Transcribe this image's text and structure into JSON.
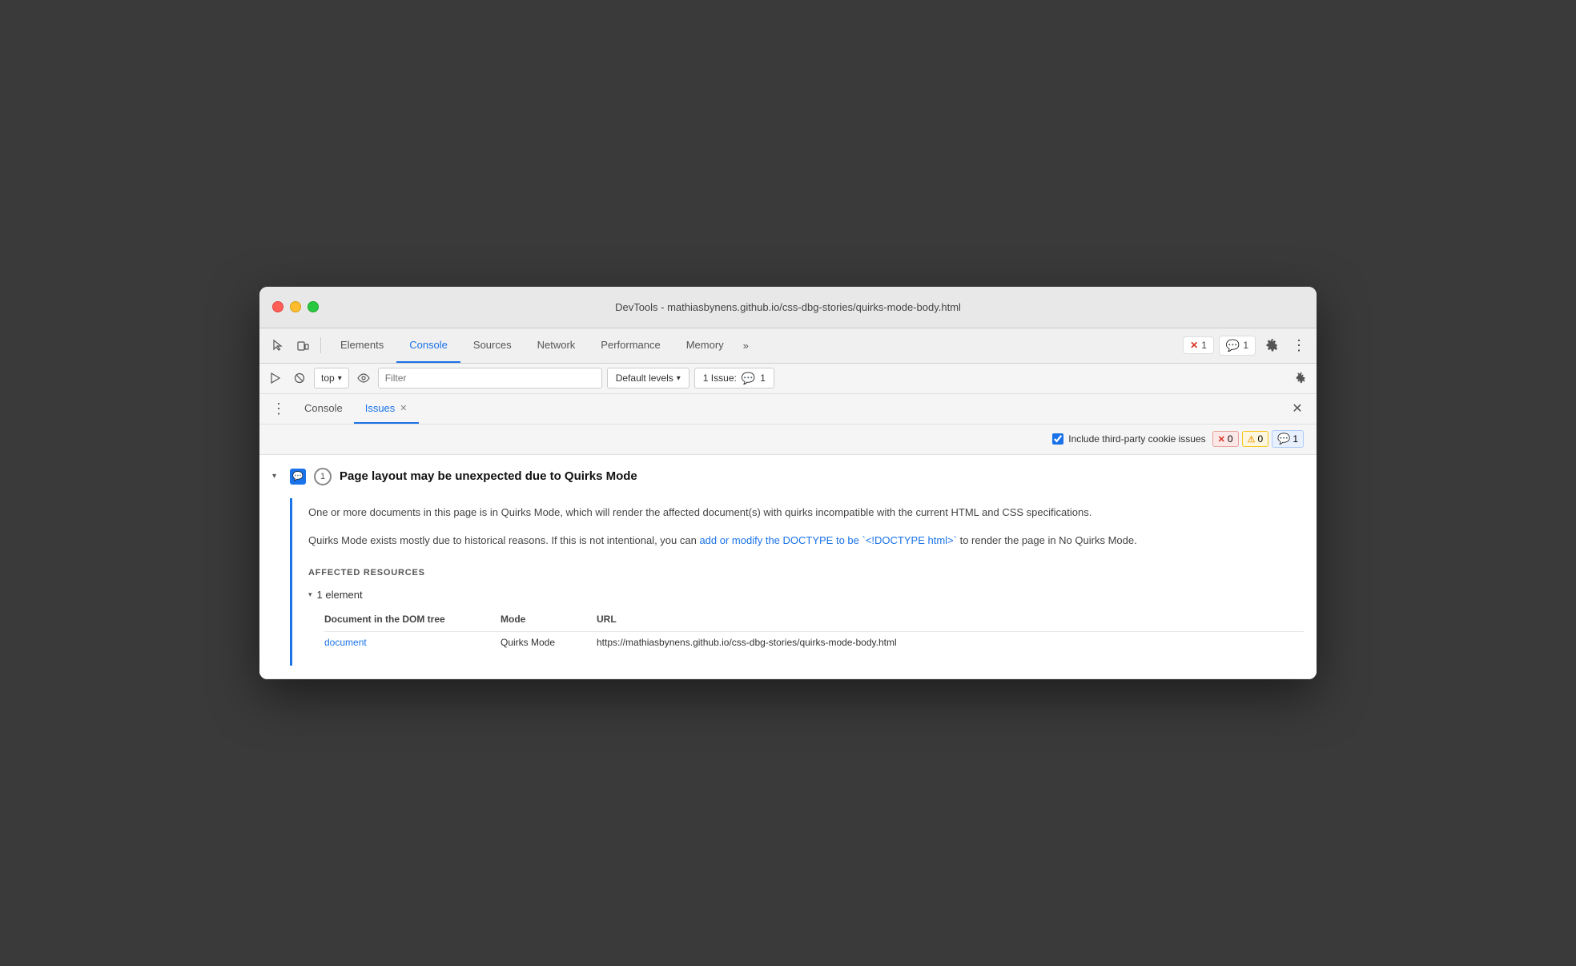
{
  "window": {
    "title": "DevTools - mathiasbynens.github.io/css-dbg-stories/quirks-mode-body.html"
  },
  "toolbar": {
    "tabs": [
      {
        "id": "elements",
        "label": "Elements",
        "active": false
      },
      {
        "id": "console",
        "label": "Console",
        "active": true
      },
      {
        "id": "sources",
        "label": "Sources",
        "active": false
      },
      {
        "id": "network",
        "label": "Network",
        "active": false
      },
      {
        "id": "performance",
        "label": "Performance",
        "active": false
      },
      {
        "id": "memory",
        "label": "Memory",
        "active": false
      }
    ],
    "more_label": "»",
    "error_count": "1",
    "message_count": "1"
  },
  "console_toolbar": {
    "top_label": "top",
    "filter_placeholder": "Filter",
    "default_levels_label": "Default levels",
    "issue_badge_label": "1 Issue:",
    "issue_badge_count": "1"
  },
  "panel": {
    "tabs": [
      {
        "id": "console",
        "label": "Console",
        "active": false,
        "closeable": false
      },
      {
        "id": "issues",
        "label": "Issues",
        "active": true,
        "closeable": true
      }
    ]
  },
  "issues_header": {
    "cookie_label": "Include third-party cookie issues",
    "error_count": "0",
    "warning_count": "0",
    "info_count": "1"
  },
  "issue": {
    "title": "Page layout may be unexpected due to Quirks Mode",
    "count": "1",
    "description_1": "One or more documents in this page is in Quirks Mode, which will render the affected document(s) with quirks incompatible with the current HTML and CSS specifications.",
    "description_2_before": "Quirks Mode exists mostly due to historical reasons. If this is not intentional, you can ",
    "description_2_link": "add or modify the DOCTYPE to be `<!DOCTYPE html>`",
    "description_2_after": " to render the page in No Quirks Mode.",
    "affected_resources_label": "AFFECTED RESOURCES",
    "element_count_label": "1 element",
    "col_document": "Document in the DOM tree",
    "col_mode": "Mode",
    "col_url": "URL",
    "resource_link": "document",
    "resource_mode": "Quirks Mode",
    "resource_url": "https://mathiasbynens.github.io/css-dbg-stories/quirks-mode-body.html"
  },
  "icons": {
    "cursor": "⬚",
    "device": "⬛",
    "play": "▶",
    "ban": "🚫",
    "eye": "👁",
    "chevron_down": "▾",
    "chevron_right": "▸",
    "settings": "⚙",
    "dots_vertical": "⋮",
    "close": "✕",
    "error_x": "✕",
    "warning": "⚠",
    "info": "💬"
  }
}
